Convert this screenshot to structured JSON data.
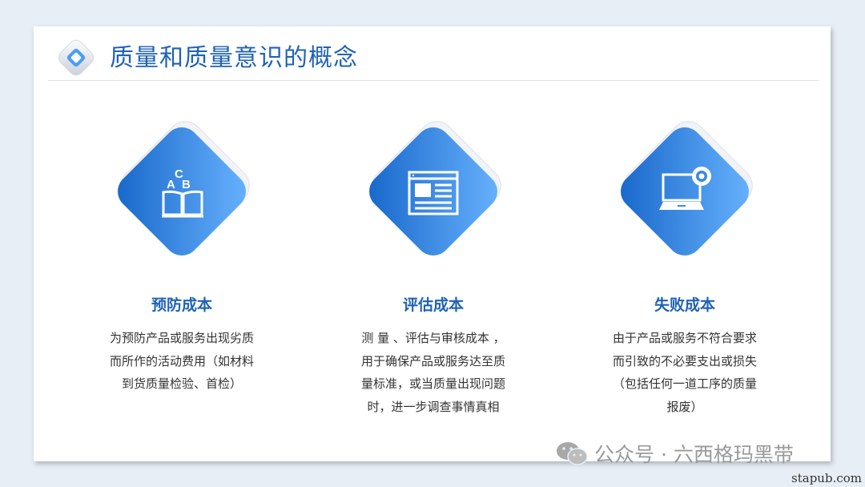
{
  "header": {
    "title": "质量和质量意识的概念"
  },
  "colors": {
    "accent": "#1f63b5",
    "diamond_light": "#6ab4ff",
    "diamond_dark": "#1565c8",
    "text": "#333333"
  },
  "cards": [
    {
      "icon": "book-abc-icon",
      "title": "预防成本",
      "lines": [
        "为预防产品或服务出现劣质",
        "而所作的活动费用（如材料",
        "到货质量检验、首检）"
      ]
    },
    {
      "icon": "document-icon",
      "title": "评估成本",
      "lines": [
        "测 量 、评估与审核成本 ，",
        "用于确保产品或服务达至质",
        "量标准，或当质量出现问题",
        "时，进一步调查事情真相"
      ]
    },
    {
      "icon": "laptop-webcam-icon",
      "title": "失败成本",
      "lines": [
        "由于产品或服务不符合要求",
        "而引致的不必要支出或损失",
        "（包括任何一道工序的质量",
        "报废）"
      ]
    }
  ],
  "watermark": {
    "text": "公众号 · 六西格玛黑带",
    "icon": "wechat-icon"
  },
  "site": {
    "text": "stapub.com"
  }
}
